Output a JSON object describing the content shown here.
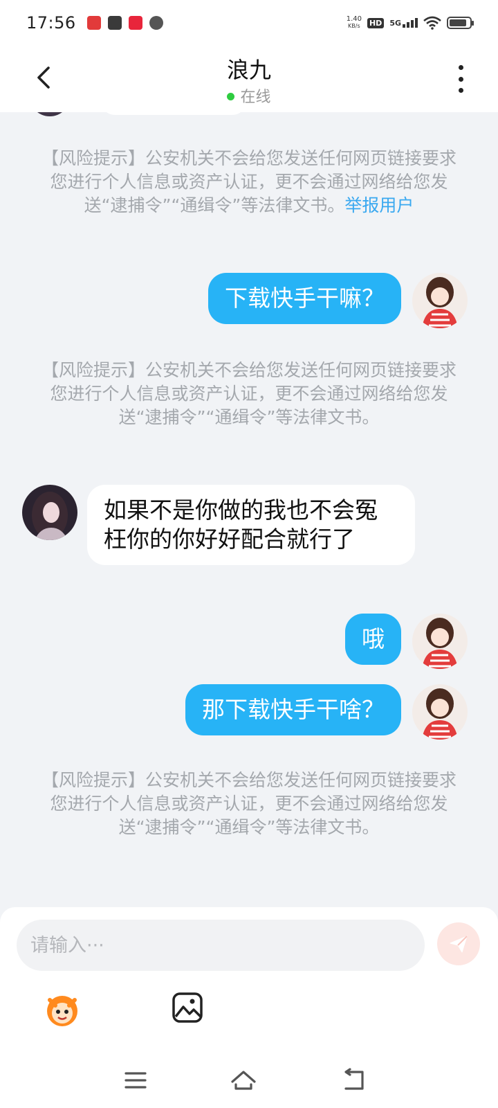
{
  "status_bar": {
    "time": "17:56",
    "net_speed_value": "1.40",
    "net_speed_unit": "KB/s",
    "hd_label": "HD",
    "network_label": "5G",
    "battery_level": 0.85
  },
  "header": {
    "title": "浪九",
    "status": "在线"
  },
  "risk_notice": {
    "text": "【风险提示】公安机关不会给您发送任何网页链接要求您进行个人信息或资产认证，更不会通过网络给您发送“逮捕令”“通缉令”等法律文书。",
    "report_link": "举报用户"
  },
  "messages": [
    {
      "sender": "me",
      "text": "下载快手干嘛？"
    },
    {
      "sender": "other",
      "text": "如果不是你做的我也不会冤枉你的你好好配合就行了"
    },
    {
      "sender": "me",
      "text": "哦"
    },
    {
      "sender": "me",
      "text": "那下载快手干啥？"
    }
  ],
  "composer": {
    "placeholder": "请输入···"
  },
  "colors": {
    "my_bubble": "#27b3f6",
    "link": "#39a8f0",
    "online_dot": "#2ecc40"
  },
  "icons": {
    "back": "chevron-left-icon",
    "more": "more-vertical-icon",
    "send": "send-icon",
    "emoji": "emoji-mascot-icon",
    "image": "image-icon",
    "nav_menu": "menu-icon",
    "nav_home": "home-icon",
    "nav_back": "back-icon"
  }
}
